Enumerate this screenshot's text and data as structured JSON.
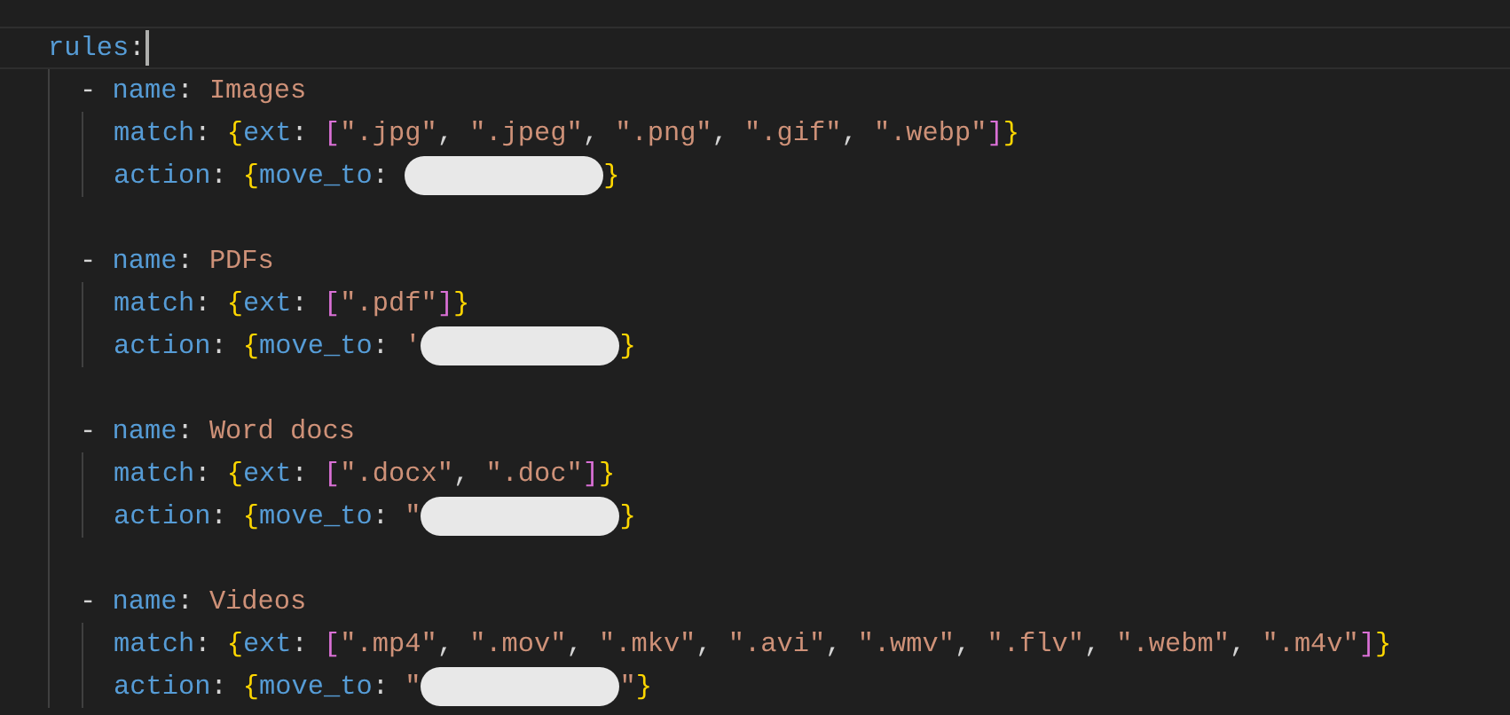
{
  "editor": {
    "root": {
      "key": "rules",
      "colon": ":",
      "cursor_line": true
    },
    "rules": [
      {
        "lines": [
          [
            {
              "kind": "dash",
              "text": "- "
            },
            {
              "kind": "key",
              "text": "name"
            },
            {
              "kind": "punct",
              "text": ": "
            },
            {
              "kind": "string",
              "text": "Images"
            }
          ],
          [
            {
              "kind": "key",
              "text": "match"
            },
            {
              "kind": "punct",
              "text": ": "
            },
            {
              "kind": "brace",
              "text": "{"
            },
            {
              "kind": "key",
              "text": "ext"
            },
            {
              "kind": "punct",
              "text": ": "
            },
            {
              "kind": "bracket",
              "text": "["
            },
            {
              "kind": "string",
              "text": "\".jpg\""
            },
            {
              "kind": "punct",
              "text": ", "
            },
            {
              "kind": "string",
              "text": "\".jpeg\""
            },
            {
              "kind": "punct",
              "text": ", "
            },
            {
              "kind": "string",
              "text": "\".png\""
            },
            {
              "kind": "punct",
              "text": ", "
            },
            {
              "kind": "string",
              "text": "\".gif\""
            },
            {
              "kind": "punct",
              "text": ", "
            },
            {
              "kind": "string",
              "text": "\".webp\""
            },
            {
              "kind": "bracket",
              "text": "]"
            },
            {
              "kind": "brace",
              "text": "}"
            }
          ],
          [
            {
              "kind": "key",
              "text": "action"
            },
            {
              "kind": "punct",
              "text": ": "
            },
            {
              "kind": "brace",
              "text": "{"
            },
            {
              "kind": "key",
              "text": "move_to"
            },
            {
              "kind": "punct",
              "text": ": "
            },
            {
              "kind": "redacted"
            },
            {
              "kind": "brace",
              "text": "}"
            }
          ]
        ]
      },
      {
        "lines": [
          [
            {
              "kind": "dash",
              "text": "- "
            },
            {
              "kind": "key",
              "text": "name"
            },
            {
              "kind": "punct",
              "text": ": "
            },
            {
              "kind": "string",
              "text": "PDFs"
            }
          ],
          [
            {
              "kind": "key",
              "text": "match"
            },
            {
              "kind": "punct",
              "text": ": "
            },
            {
              "kind": "brace",
              "text": "{"
            },
            {
              "kind": "key",
              "text": "ext"
            },
            {
              "kind": "punct",
              "text": ": "
            },
            {
              "kind": "bracket",
              "text": "["
            },
            {
              "kind": "string",
              "text": "\".pdf\""
            },
            {
              "kind": "bracket",
              "text": "]"
            },
            {
              "kind": "brace",
              "text": "}"
            }
          ],
          [
            {
              "kind": "key",
              "text": "action"
            },
            {
              "kind": "punct",
              "text": ": "
            },
            {
              "kind": "brace",
              "text": "{"
            },
            {
              "kind": "key",
              "text": "move_to"
            },
            {
              "kind": "punct",
              "text": ": "
            },
            {
              "kind": "string",
              "text": "'"
            },
            {
              "kind": "redacted"
            },
            {
              "kind": "brace",
              "text": "}"
            }
          ]
        ]
      },
      {
        "lines": [
          [
            {
              "kind": "dash",
              "text": "- "
            },
            {
              "kind": "key",
              "text": "name"
            },
            {
              "kind": "punct",
              "text": ": "
            },
            {
              "kind": "string",
              "text": "Word docs"
            }
          ],
          [
            {
              "kind": "key",
              "text": "match"
            },
            {
              "kind": "punct",
              "text": ": "
            },
            {
              "kind": "brace",
              "text": "{"
            },
            {
              "kind": "key",
              "text": "ext"
            },
            {
              "kind": "punct",
              "text": ": "
            },
            {
              "kind": "bracket",
              "text": "["
            },
            {
              "kind": "string",
              "text": "\".docx\""
            },
            {
              "kind": "punct",
              "text": ", "
            },
            {
              "kind": "string",
              "text": "\".doc\""
            },
            {
              "kind": "bracket",
              "text": "]"
            },
            {
              "kind": "brace",
              "text": "}"
            }
          ],
          [
            {
              "kind": "key",
              "text": "action"
            },
            {
              "kind": "punct",
              "text": ": "
            },
            {
              "kind": "brace",
              "text": "{"
            },
            {
              "kind": "key",
              "text": "move_to"
            },
            {
              "kind": "punct",
              "text": ": "
            },
            {
              "kind": "string",
              "text": "\""
            },
            {
              "kind": "redacted"
            },
            {
              "kind": "brace",
              "text": "}"
            }
          ]
        ]
      },
      {
        "lines": [
          [
            {
              "kind": "dash",
              "text": "- "
            },
            {
              "kind": "key",
              "text": "name"
            },
            {
              "kind": "punct",
              "text": ": "
            },
            {
              "kind": "string",
              "text": "Videos"
            }
          ],
          [
            {
              "kind": "key",
              "text": "match"
            },
            {
              "kind": "punct",
              "text": ": "
            },
            {
              "kind": "brace",
              "text": "{"
            },
            {
              "kind": "key",
              "text": "ext"
            },
            {
              "kind": "punct",
              "text": ": "
            },
            {
              "kind": "bracket",
              "text": "["
            },
            {
              "kind": "string",
              "text": "\".mp4\""
            },
            {
              "kind": "punct",
              "text": ", "
            },
            {
              "kind": "string",
              "text": "\".mov\""
            },
            {
              "kind": "punct",
              "text": ", "
            },
            {
              "kind": "string",
              "text": "\".mkv\""
            },
            {
              "kind": "punct",
              "text": ", "
            },
            {
              "kind": "string",
              "text": "\".avi\""
            },
            {
              "kind": "punct",
              "text": ", "
            },
            {
              "kind": "string",
              "text": "\".wmv\""
            },
            {
              "kind": "punct",
              "text": ", "
            },
            {
              "kind": "string",
              "text": "\".flv\""
            },
            {
              "kind": "punct",
              "text": ", "
            },
            {
              "kind": "string",
              "text": "\".webm\""
            },
            {
              "kind": "punct",
              "text": ", "
            },
            {
              "kind": "string",
              "text": "\".m4v\""
            },
            {
              "kind": "bracket",
              "text": "]"
            },
            {
              "kind": "brace",
              "text": "}"
            }
          ],
          [
            {
              "kind": "key",
              "text": "action"
            },
            {
              "kind": "punct",
              "text": ": "
            },
            {
              "kind": "brace",
              "text": "{"
            },
            {
              "kind": "key",
              "text": "move_to"
            },
            {
              "kind": "punct",
              "text": ": "
            },
            {
              "kind": "string",
              "text": "\""
            },
            {
              "kind": "redacted"
            },
            {
              "kind": "string",
              "text": "\""
            },
            {
              "kind": "brace",
              "text": "}"
            }
          ]
        ]
      }
    ]
  }
}
